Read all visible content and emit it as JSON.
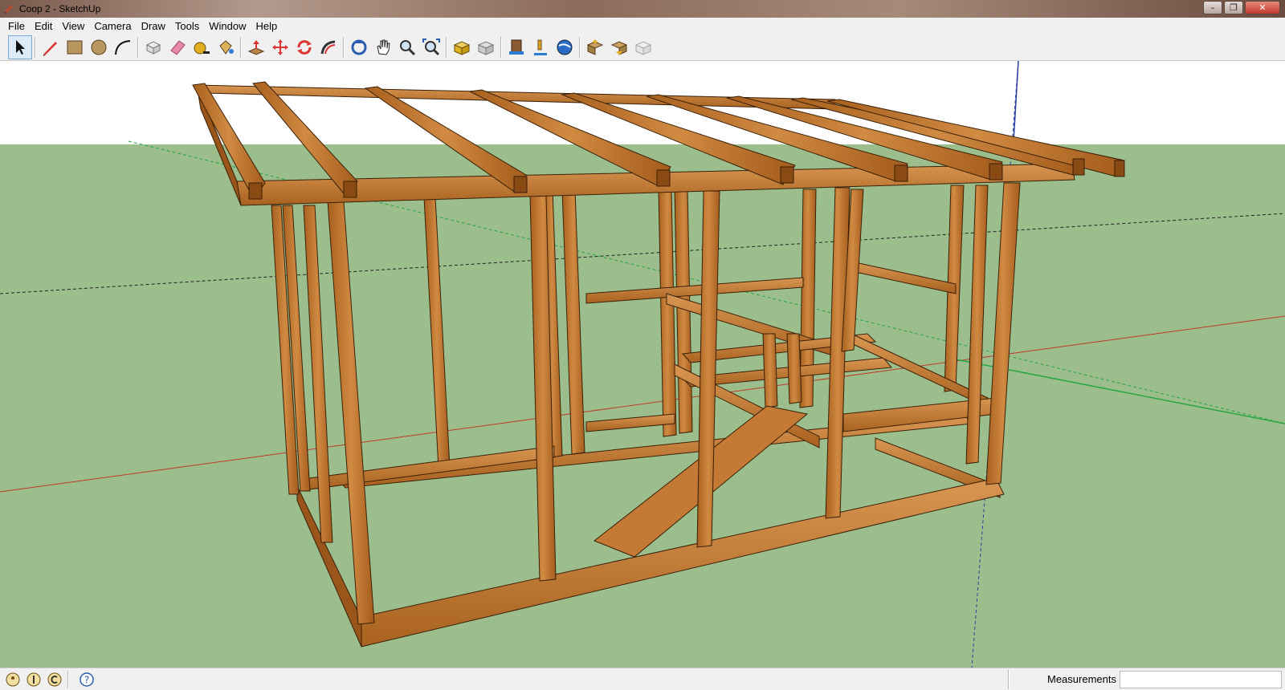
{
  "window": {
    "title": "Coop 2 - SketchUp",
    "controls": [
      "minimize",
      "maximize",
      "close"
    ]
  },
  "menubar": {
    "items": [
      {
        "label": "File"
      },
      {
        "label": "Edit"
      },
      {
        "label": "View"
      },
      {
        "label": "Camera"
      },
      {
        "label": "Draw"
      },
      {
        "label": "Tools"
      },
      {
        "label": "Window"
      },
      {
        "label": "Help"
      }
    ]
  },
  "toolbar": {
    "groups": [
      [
        "select-icon"
      ],
      [
        "pencil-line-icon",
        "rectangle-icon",
        "circle-icon",
        "arc-icon"
      ],
      [
        "make-component-icon",
        "eraser-icon",
        "tape-measure-icon",
        "paint-bucket-icon"
      ],
      [
        "push-pull-icon",
        "move-icon",
        "rotate-icon",
        "follow-me-icon"
      ],
      [
        "orbit-icon",
        "pan-icon",
        "zoom-icon",
        "zoom-extents-icon"
      ],
      [
        "get-models-icon",
        "share-model-icon"
      ],
      [
        "get-photo-texture-icon",
        "add-location-icon",
        "google-earth-icon"
      ],
      [
        "warehouse-upload-icon",
        "warehouse-download-icon",
        "extension-warehouse-icon"
      ]
    ]
  },
  "viewport": {
    "sky_color": "#ffffff",
    "ground_color": "#9cbe8c",
    "wood_color": "#c0762f",
    "axes": {
      "red": "#c0392b",
      "green": "#27a644",
      "blue": "#2b3f9e"
    }
  },
  "statusbar": {
    "icons": [
      "geo-location-icon",
      "credits-icon",
      "sign-in-icon",
      "help-icon"
    ],
    "measurements_label": "Measurements",
    "measurements_value": ""
  }
}
